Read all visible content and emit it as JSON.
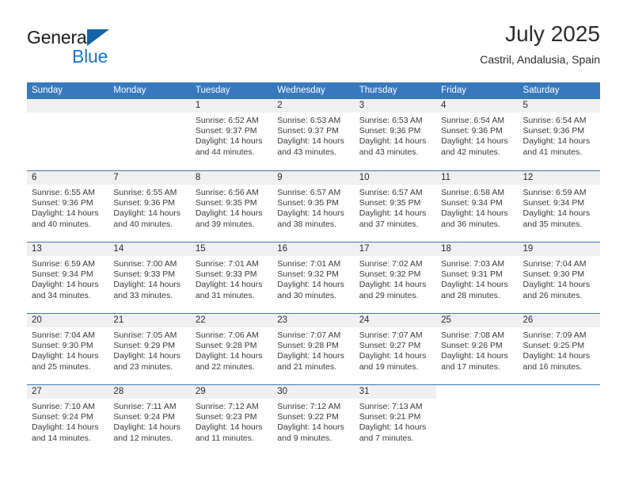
{
  "brand": {
    "name_part1": "General",
    "name_part2": "Blue",
    "triangle_icon": "triangle-icon",
    "accent_color": "#1976d2",
    "logo_triangle_color": "#1464ab"
  },
  "header": {
    "month_title": "July 2025",
    "location": "Castril, Andalusia, Spain"
  },
  "calendar": {
    "header_color": "#3878bd",
    "day_band_color": "#f0f0f0",
    "weekdays": [
      "Sunday",
      "Monday",
      "Tuesday",
      "Wednesday",
      "Thursday",
      "Friday",
      "Saturday"
    ],
    "weeks": [
      [
        {
          "day": "",
          "sunrise": "",
          "sunset": "",
          "daylight1": "",
          "daylight2": "",
          "empty": true
        },
        {
          "day": "",
          "sunrise": "",
          "sunset": "",
          "daylight1": "",
          "daylight2": "",
          "empty": true
        },
        {
          "day": "1",
          "sunrise": "Sunrise: 6:52 AM",
          "sunset": "Sunset: 9:37 PM",
          "daylight1": "Daylight: 14 hours",
          "daylight2": "and 44 minutes."
        },
        {
          "day": "2",
          "sunrise": "Sunrise: 6:53 AM",
          "sunset": "Sunset: 9:37 PM",
          "daylight1": "Daylight: 14 hours",
          "daylight2": "and 43 minutes."
        },
        {
          "day": "3",
          "sunrise": "Sunrise: 6:53 AM",
          "sunset": "Sunset: 9:36 PM",
          "daylight1": "Daylight: 14 hours",
          "daylight2": "and 43 minutes."
        },
        {
          "day": "4",
          "sunrise": "Sunrise: 6:54 AM",
          "sunset": "Sunset: 9:36 PM",
          "daylight1": "Daylight: 14 hours",
          "daylight2": "and 42 minutes."
        },
        {
          "day": "5",
          "sunrise": "Sunrise: 6:54 AM",
          "sunset": "Sunset: 9:36 PM",
          "daylight1": "Daylight: 14 hours",
          "daylight2": "and 41 minutes."
        }
      ],
      [
        {
          "day": "6",
          "sunrise": "Sunrise: 6:55 AM",
          "sunset": "Sunset: 9:36 PM",
          "daylight1": "Daylight: 14 hours",
          "daylight2": "and 40 minutes."
        },
        {
          "day": "7",
          "sunrise": "Sunrise: 6:55 AM",
          "sunset": "Sunset: 9:36 PM",
          "daylight1": "Daylight: 14 hours",
          "daylight2": "and 40 minutes."
        },
        {
          "day": "8",
          "sunrise": "Sunrise: 6:56 AM",
          "sunset": "Sunset: 9:35 PM",
          "daylight1": "Daylight: 14 hours",
          "daylight2": "and 39 minutes."
        },
        {
          "day": "9",
          "sunrise": "Sunrise: 6:57 AM",
          "sunset": "Sunset: 9:35 PM",
          "daylight1": "Daylight: 14 hours",
          "daylight2": "and 38 minutes."
        },
        {
          "day": "10",
          "sunrise": "Sunrise: 6:57 AM",
          "sunset": "Sunset: 9:35 PM",
          "daylight1": "Daylight: 14 hours",
          "daylight2": "and 37 minutes."
        },
        {
          "day": "11",
          "sunrise": "Sunrise: 6:58 AM",
          "sunset": "Sunset: 9:34 PM",
          "daylight1": "Daylight: 14 hours",
          "daylight2": "and 36 minutes."
        },
        {
          "day": "12",
          "sunrise": "Sunrise: 6:59 AM",
          "sunset": "Sunset: 9:34 PM",
          "daylight1": "Daylight: 14 hours",
          "daylight2": "and 35 minutes."
        }
      ],
      [
        {
          "day": "13",
          "sunrise": "Sunrise: 6:59 AM",
          "sunset": "Sunset: 9:34 PM",
          "daylight1": "Daylight: 14 hours",
          "daylight2": "and 34 minutes."
        },
        {
          "day": "14",
          "sunrise": "Sunrise: 7:00 AM",
          "sunset": "Sunset: 9:33 PM",
          "daylight1": "Daylight: 14 hours",
          "daylight2": "and 33 minutes."
        },
        {
          "day": "15",
          "sunrise": "Sunrise: 7:01 AM",
          "sunset": "Sunset: 9:33 PM",
          "daylight1": "Daylight: 14 hours",
          "daylight2": "and 31 minutes."
        },
        {
          "day": "16",
          "sunrise": "Sunrise: 7:01 AM",
          "sunset": "Sunset: 9:32 PM",
          "daylight1": "Daylight: 14 hours",
          "daylight2": "and 30 minutes."
        },
        {
          "day": "17",
          "sunrise": "Sunrise: 7:02 AM",
          "sunset": "Sunset: 9:32 PM",
          "daylight1": "Daylight: 14 hours",
          "daylight2": "and 29 minutes."
        },
        {
          "day": "18",
          "sunrise": "Sunrise: 7:03 AM",
          "sunset": "Sunset: 9:31 PM",
          "daylight1": "Daylight: 14 hours",
          "daylight2": "and 28 minutes."
        },
        {
          "day": "19",
          "sunrise": "Sunrise: 7:04 AM",
          "sunset": "Sunset: 9:30 PM",
          "daylight1": "Daylight: 14 hours",
          "daylight2": "and 26 minutes."
        }
      ],
      [
        {
          "day": "20",
          "sunrise": "Sunrise: 7:04 AM",
          "sunset": "Sunset: 9:30 PM",
          "daylight1": "Daylight: 14 hours",
          "daylight2": "and 25 minutes."
        },
        {
          "day": "21",
          "sunrise": "Sunrise: 7:05 AM",
          "sunset": "Sunset: 9:29 PM",
          "daylight1": "Daylight: 14 hours",
          "daylight2": "and 23 minutes."
        },
        {
          "day": "22",
          "sunrise": "Sunrise: 7:06 AM",
          "sunset": "Sunset: 9:28 PM",
          "daylight1": "Daylight: 14 hours",
          "daylight2": "and 22 minutes."
        },
        {
          "day": "23",
          "sunrise": "Sunrise: 7:07 AM",
          "sunset": "Sunset: 9:28 PM",
          "daylight1": "Daylight: 14 hours",
          "daylight2": "and 21 minutes."
        },
        {
          "day": "24",
          "sunrise": "Sunrise: 7:07 AM",
          "sunset": "Sunset: 9:27 PM",
          "daylight1": "Daylight: 14 hours",
          "daylight2": "and 19 minutes."
        },
        {
          "day": "25",
          "sunrise": "Sunrise: 7:08 AM",
          "sunset": "Sunset: 9:26 PM",
          "daylight1": "Daylight: 14 hours",
          "daylight2": "and 17 minutes."
        },
        {
          "day": "26",
          "sunrise": "Sunrise: 7:09 AM",
          "sunset": "Sunset: 9:25 PM",
          "daylight1": "Daylight: 14 hours",
          "daylight2": "and 16 minutes."
        }
      ],
      [
        {
          "day": "27",
          "sunrise": "Sunrise: 7:10 AM",
          "sunset": "Sunset: 9:24 PM",
          "daylight1": "Daylight: 14 hours",
          "daylight2": "and 14 minutes."
        },
        {
          "day": "28",
          "sunrise": "Sunrise: 7:11 AM",
          "sunset": "Sunset: 9:24 PM",
          "daylight1": "Daylight: 14 hours",
          "daylight2": "and 12 minutes."
        },
        {
          "day": "29",
          "sunrise": "Sunrise: 7:12 AM",
          "sunset": "Sunset: 9:23 PM",
          "daylight1": "Daylight: 14 hours",
          "daylight2": "and 11 minutes."
        },
        {
          "day": "30",
          "sunrise": "Sunrise: 7:12 AM",
          "sunset": "Sunset: 9:22 PM",
          "daylight1": "Daylight: 14 hours",
          "daylight2": "and 9 minutes."
        },
        {
          "day": "31",
          "sunrise": "Sunrise: 7:13 AM",
          "sunset": "Sunset: 9:21 PM",
          "daylight1": "Daylight: 14 hours",
          "daylight2": "and 7 minutes."
        },
        {
          "day": "",
          "sunrise": "",
          "sunset": "",
          "daylight1": "",
          "daylight2": "",
          "blank": true
        },
        {
          "day": "",
          "sunrise": "",
          "sunset": "",
          "daylight1": "",
          "daylight2": "",
          "blank": true
        }
      ]
    ]
  }
}
